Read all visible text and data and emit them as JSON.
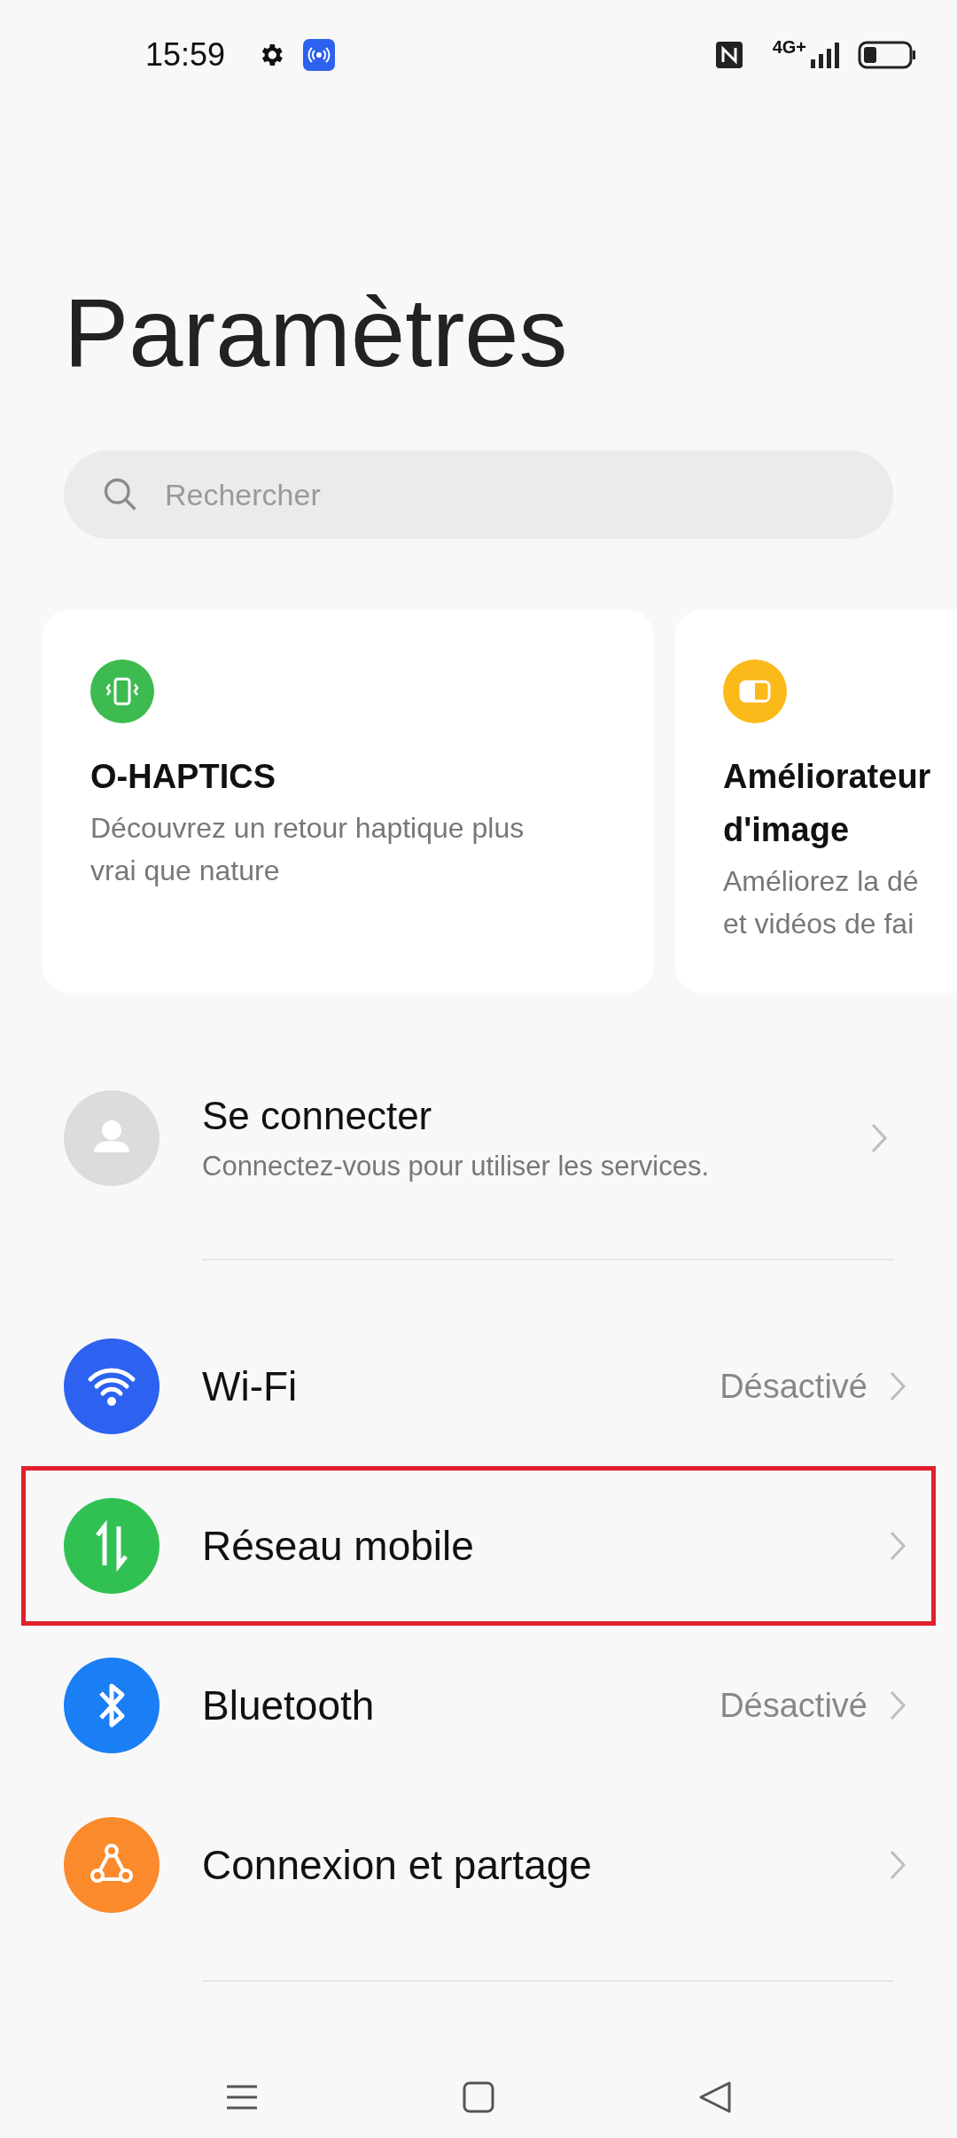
{
  "status_bar": {
    "time": "15:59",
    "network": "4G+"
  },
  "title": "Paramètres",
  "search": {
    "placeholder": "Rechercher"
  },
  "cards": [
    {
      "kind": "haptics",
      "color": "#3dbb50",
      "title_lines": [
        "O-HAPTICS"
      ],
      "description_lines": [
        "Découvrez un retour haptique plus",
        "vrai que nature"
      ]
    },
    {
      "kind": "image",
      "color": "#fbb91a",
      "title_lines": [
        "Améliorateur",
        "d'image"
      ],
      "description_lines": [
        "Améliorez la dé",
        "et vidéos de fai"
      ]
    }
  ],
  "account": {
    "title": "Se connecter",
    "subtitle": "Connectez-vous pour utiliser les services."
  },
  "items": [
    {
      "kind": "wifi",
      "color": "#2c62ef",
      "label": "Wi-Fi",
      "value": "Désactivé",
      "highlighted": false
    },
    {
      "kind": "mobile",
      "color": "#31c152",
      "label": "Réseau mobile",
      "highlighted": true
    },
    {
      "kind": "bluetooth",
      "color": "#1a7ef5",
      "label": "Bluetooth",
      "value": "Désactivé",
      "highlighted": false
    },
    {
      "kind": "share",
      "color": "#fb8a2c",
      "label": "Connexion et partage",
      "highlighted": false
    }
  ]
}
